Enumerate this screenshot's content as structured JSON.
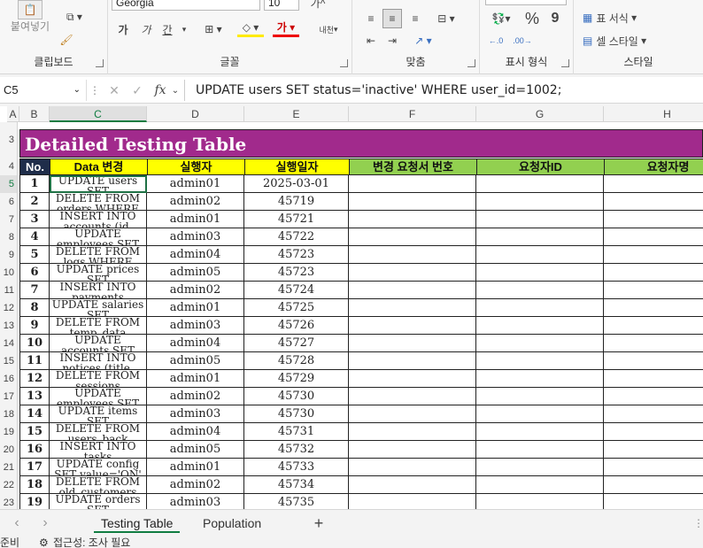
{
  "ribbon": {
    "clipboard": {
      "paste_label": "붙여넣기",
      "group_label": "클립보드"
    },
    "font": {
      "font_name": "Georgia",
      "font_size": "10",
      "group_label": "글꼴",
      "bold": "가",
      "italic": "가",
      "underline": "간",
      "phonetic": "내천"
    },
    "alignment": {
      "group_label": "맞춤"
    },
    "number": {
      "group_label": "표시 형식",
      "percent": "%",
      "comma": "9"
    },
    "styles": {
      "group_label": "스타일",
      "format_table": "표 서식",
      "cell_styles": "셀 스타일"
    }
  },
  "formula_bar": {
    "name_box": "C5",
    "fx": "fx",
    "formula": "UPDATE users SET status='inactive' WHERE user_id=1002;"
  },
  "columns": [
    "A",
    "B",
    "C",
    "D",
    "E",
    "F",
    "G",
    "H"
  ],
  "rows_visible": [
    "3",
    "4",
    "5",
    "6",
    "7",
    "8",
    "9",
    "10",
    "11",
    "12",
    "13",
    "14",
    "15",
    "16",
    "17",
    "18",
    "19",
    "20",
    "21",
    "22",
    "23"
  ],
  "sheet": {
    "title": "Detailed Testing Table",
    "headers": [
      "No.",
      "Data 변경",
      "실행자",
      "실행일자",
      "변경 요청서 번호",
      "요청자ID",
      "요청자명"
    ],
    "records": [
      {
        "no": "1",
        "data": "UPDATE users SET",
        "user": "admin01",
        "date": "2025-03-01"
      },
      {
        "no": "2",
        "data": "DELETE FROM orders WHERE",
        "user": "admin02",
        "date": "45719"
      },
      {
        "no": "3",
        "data": "INSERT INTO accounts (id,",
        "user": "admin01",
        "date": "45721"
      },
      {
        "no": "4",
        "data": "UPDATE employees SET",
        "user": "admin03",
        "date": "45722"
      },
      {
        "no": "5",
        "data": "DELETE FROM logs WHERE",
        "user": "admin04",
        "date": "45723"
      },
      {
        "no": "6",
        "data": "UPDATE prices SET",
        "user": "admin05",
        "date": "45723"
      },
      {
        "no": "7",
        "data": "INSERT INTO payments",
        "user": "admin02",
        "date": "45724"
      },
      {
        "no": "8",
        "data": "UPDATE salaries SET",
        "user": "admin01",
        "date": "45725"
      },
      {
        "no": "9",
        "data": "DELETE FROM temp_data",
        "user": "admin03",
        "date": "45726"
      },
      {
        "no": "10",
        "data": "UPDATE accounts SET",
        "user": "admin04",
        "date": "45727"
      },
      {
        "no": "11",
        "data": "INSERT INTO notices (title,",
        "user": "admin05",
        "date": "45728"
      },
      {
        "no": "12",
        "data": "DELETE FROM sessions",
        "user": "admin01",
        "date": "45729"
      },
      {
        "no": "13",
        "data": "UPDATE employees SET",
        "user": "admin02",
        "date": "45730"
      },
      {
        "no": "14",
        "data": "UPDATE items SET",
        "user": "admin03",
        "date": "45730"
      },
      {
        "no": "15",
        "data": "DELETE FROM users_back",
        "user": "admin04",
        "date": "45731"
      },
      {
        "no": "16",
        "data": "INSERT INTO tasks",
        "user": "admin05",
        "date": "45732"
      },
      {
        "no": "17",
        "data": "UPDATE config SET value='ON'",
        "user": "admin01",
        "date": "45733"
      },
      {
        "no": "18",
        "data": "DELETE FROM old_customers",
        "user": "admin02",
        "date": "45734"
      },
      {
        "no": "19",
        "data": "UPDATE orders SET",
        "user": "admin03",
        "date": "45735"
      }
    ]
  },
  "tabs": [
    "Testing Table",
    "Population"
  ],
  "add_sheet": "+",
  "status": {
    "ready": "준비",
    "accessibility": "접근성: 조사 필요"
  },
  "colors": {
    "title_bg": "#a12a8c",
    "yellow": "#ffff00",
    "green": "#92d050",
    "navy": "#1f2d4a",
    "accent": "#107c41"
  }
}
